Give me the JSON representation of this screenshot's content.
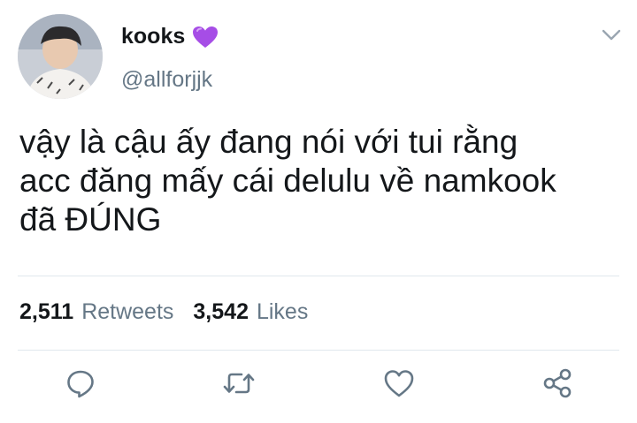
{
  "tweet": {
    "author": {
      "display_name": "kooks",
      "handle": "@allforjjk",
      "avatar_icon": "profile-avatar",
      "emoji_icon": "purple-heart-icon"
    },
    "menu_icon": "chevron-down-icon",
    "text_lines": [
      "vậy là cậu ấy đang nói với tui rằng",
      "acc đăng mấy cái delulu về namkook",
      "đã ĐÚNG"
    ],
    "stats": {
      "retweets_count": "2,511",
      "retweets_label": "Retweets",
      "likes_count": "3,542",
      "likes_label": "Likes"
    },
    "actions": [
      {
        "name": "reply",
        "icon": "reply-icon"
      },
      {
        "name": "retweet",
        "icon": "retweet-icon"
      },
      {
        "name": "like",
        "icon": "heart-icon"
      },
      {
        "name": "share",
        "icon": "share-icon"
      }
    ]
  },
  "colors": {
    "text_primary": "#14171a",
    "text_secondary": "#657786",
    "icon_gray": "#657786",
    "divider": "#e1e8ed",
    "emoji_purple": "#a64de6"
  }
}
